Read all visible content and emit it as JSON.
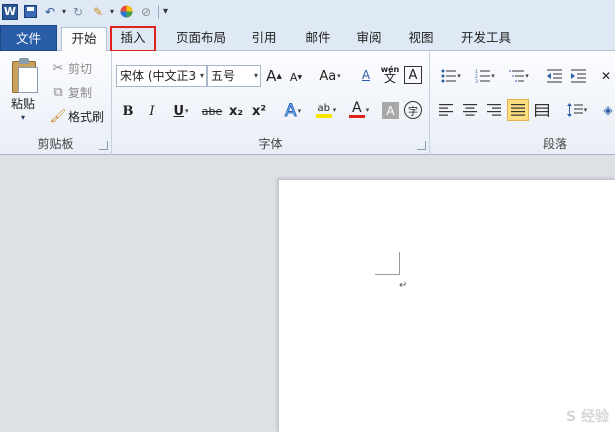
{
  "qat": {
    "icons": [
      "word-logo",
      "save-icon",
      "undo-icon",
      "redo-icon",
      "format-painter-icon",
      "color-icon",
      "clear-format-icon",
      "customize-icon"
    ]
  },
  "tabs": [
    {
      "label": "文件"
    },
    {
      "label": "开始"
    },
    {
      "label": "插入"
    },
    {
      "label": "页面布局"
    },
    {
      "label": "引用"
    },
    {
      "label": "邮件"
    },
    {
      "label": "审阅"
    },
    {
      "label": "视图"
    },
    {
      "label": "开发工具"
    }
  ],
  "clipboard": {
    "paste": "粘贴",
    "cut": "剪切",
    "copy": "复制",
    "format_painter": "格式刷",
    "group_label": "剪贴板"
  },
  "font": {
    "font_name": "宋体 (中文正3",
    "font_size": "五号",
    "group_label": "字体",
    "buttons": {
      "grow": "A",
      "shrink": "A",
      "case": "Aa",
      "clear": "A",
      "phonetic": "wén",
      "border": "A",
      "bold": "B",
      "italic": "I",
      "underline": "U",
      "strike": "abe",
      "subscript": "x₂",
      "superscript": "x²",
      "effects": "A",
      "highlight": "ab",
      "font_color": "A",
      "shading": "A",
      "enclosed": "字"
    }
  },
  "paragraph": {
    "group_label": "段落"
  },
  "colors": {
    "file_tab": "#2a5da8",
    "highlight_outline": "#e0211c",
    "font_color_bar": "#e0211c",
    "highlight_bar": "#f5e600"
  },
  "document": {
    "paragraph_mark": "↵",
    "watermark": "S 经验"
  }
}
